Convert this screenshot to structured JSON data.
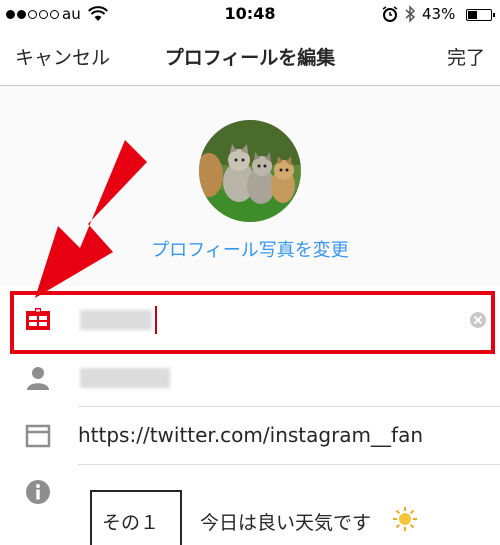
{
  "status_bar": {
    "carrier": "au",
    "time": "10:48",
    "battery_percent": "43%",
    "battery_level": 0.43,
    "signal_bars_filled": 2,
    "signal_bars_total": 5
  },
  "nav": {
    "cancel_label": "キャンセル",
    "title": "プロフィールを編集",
    "done_label": "完了"
  },
  "profile_photo": {
    "change_label": "プロフィール写真を変更"
  },
  "fields": {
    "name": {
      "icon": "id-card-icon"
    },
    "username": {
      "icon": "person-icon"
    },
    "website": {
      "icon": "browser-window-icon",
      "value": "https://twitter.com/instagram__fan"
    },
    "bio": {
      "icon": "info-icon",
      "box_label": "その１",
      "text": "今日は良い天気です",
      "emoji": "sun-icon"
    }
  },
  "colors": {
    "accent_blue": "#3897f0",
    "highlight_red": "#e60012",
    "icon_gray": "#8e8e8e"
  }
}
